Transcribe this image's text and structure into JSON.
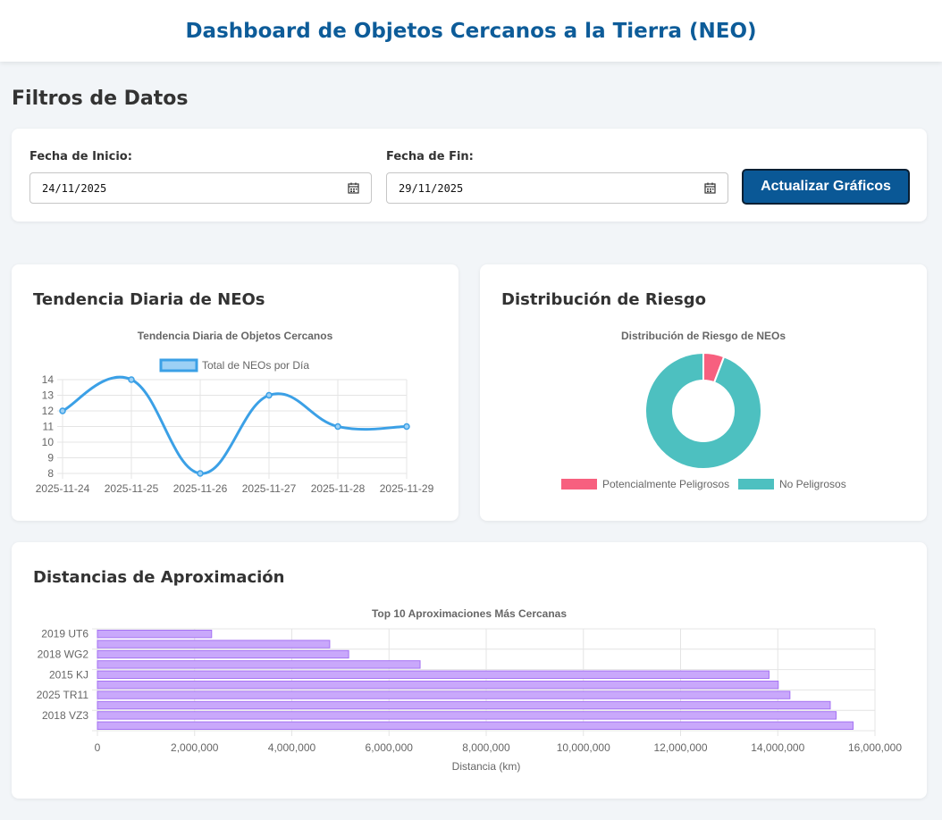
{
  "header": {
    "title": "Dashboard de Objetos Cercanos a la Tierra (NEO)"
  },
  "filters": {
    "section_title": "Filtros de Datos",
    "start_label": "Fecha de Inicio:",
    "start_value": "24/11/2025",
    "end_label": "Fecha de Fin:",
    "end_value": "29/11/2025",
    "update_button": "Actualizar Gráficos"
  },
  "cards": {
    "trend_title": "Tendencia Diaria de NEOs",
    "risk_title": "Distribución de Riesgo",
    "distance_title": "Distancias de Aproximación"
  },
  "colors": {
    "line": "#3ba0e6",
    "line_fill": "#9cd0f5",
    "hazardous": "#f7607f",
    "safe": "#4dc0c0",
    "bar_fill": "#c9a8fb",
    "bar_stroke": "#a573f3"
  },
  "chart_data": [
    {
      "type": "line",
      "title": "Tendencia Diaria de Objetos Cercanos",
      "x": [
        "2025-11-24",
        "2025-11-25",
        "2025-11-26",
        "2025-11-27",
        "2025-11-28",
        "2025-11-29"
      ],
      "series": [
        {
          "name": "Total de NEOs por Día",
          "values": [
            12,
            14,
            8,
            13,
            11,
            11
          ]
        }
      ],
      "ylim": [
        8,
        14
      ],
      "yticks": [
        14,
        13,
        12,
        11,
        10,
        9,
        8
      ],
      "grid": true,
      "legend": "top"
    },
    {
      "type": "pie",
      "title": "Distribución de Riesgo de NEOs",
      "labels": [
        "Potencialmente Peligrosos",
        "No Peligrosos"
      ],
      "values": [
        4,
        65
      ],
      "legend": "bottom"
    },
    {
      "type": "bar",
      "orientation": "horizontal",
      "title": "Top 10 Aproximaciones Más Cercanas",
      "xlabel": "Distancia (km)",
      "categories": [
        "2019 UT6",
        "",
        "2018 WG2",
        "",
        "2015 KJ",
        "",
        "2025 TR11",
        "",
        "2018 VZ3",
        ""
      ],
      "values": [
        2350000,
        4780000,
        5170000,
        6640000,
        13820000,
        14010000,
        14250000,
        15080000,
        15200000,
        15550000
      ],
      "xlim": [
        0,
        16000000
      ],
      "xticks": [
        "0",
        "2,000,000",
        "4,000,000",
        "6,000,000",
        "8,000,000",
        "10,000,000",
        "12,000,000",
        "14,000,000",
        "16,000,000"
      ],
      "grid": true
    }
  ]
}
